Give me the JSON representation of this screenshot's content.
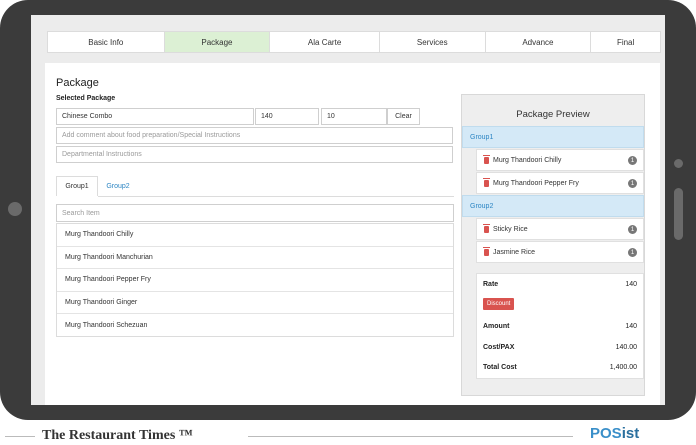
{
  "tabs": [
    "Basic Info",
    "Package",
    "Ala Carte",
    "Services",
    "Advance",
    "Final"
  ],
  "active_tab": "Package",
  "title": "Package",
  "selected_package_label": "Selected Package",
  "package_name": "Chinese Combo",
  "rate_value": "140",
  "qty_value": "10",
  "clear_label": "Clear",
  "comment_placeholder": "Add comment about food preparation/Special Instructions",
  "dept_placeholder": "Departmental Instructions",
  "group_tabs": [
    "Group1",
    "Group2"
  ],
  "search_placeholder": "Search Item",
  "items": [
    "Murg Thandoori Chilly",
    "Murg Thandoori Manchurian",
    "Murg Thandoori Pepper Fry",
    "Murg Thandoori Ginger",
    "Murg Thandoori Schezuan"
  ],
  "preview": {
    "title": "Package Preview",
    "groups": [
      {
        "name": "Group1",
        "items": [
          {
            "name": "Murg Thandoori Chilly",
            "count": "1"
          },
          {
            "name": "Murg Thandoori Pepper Fry",
            "count": "1"
          }
        ]
      },
      {
        "name": "Group2",
        "items": [
          {
            "name": "Sticky Rice",
            "count": "1"
          },
          {
            "name": "Jasmine Rice",
            "count": "1"
          }
        ]
      }
    ],
    "rate_label": "Rate",
    "rate": "140",
    "discount_label": "Discount",
    "amount_label": "Amount",
    "amount": "140",
    "cost_pax_label": "Cost/PAX",
    "cost_pax": "140.00",
    "total_label": "Total Cost",
    "total": "1,400.00"
  },
  "footer": {
    "brand": "The Restaurant Times ™",
    "logo_pos": "POS",
    "logo_ist": "ist"
  },
  "colors": {
    "active_tab": "#dcf0d4",
    "group_header": "#d4e9f7",
    "link": "#2d86c4",
    "discount": "#d9534f"
  }
}
